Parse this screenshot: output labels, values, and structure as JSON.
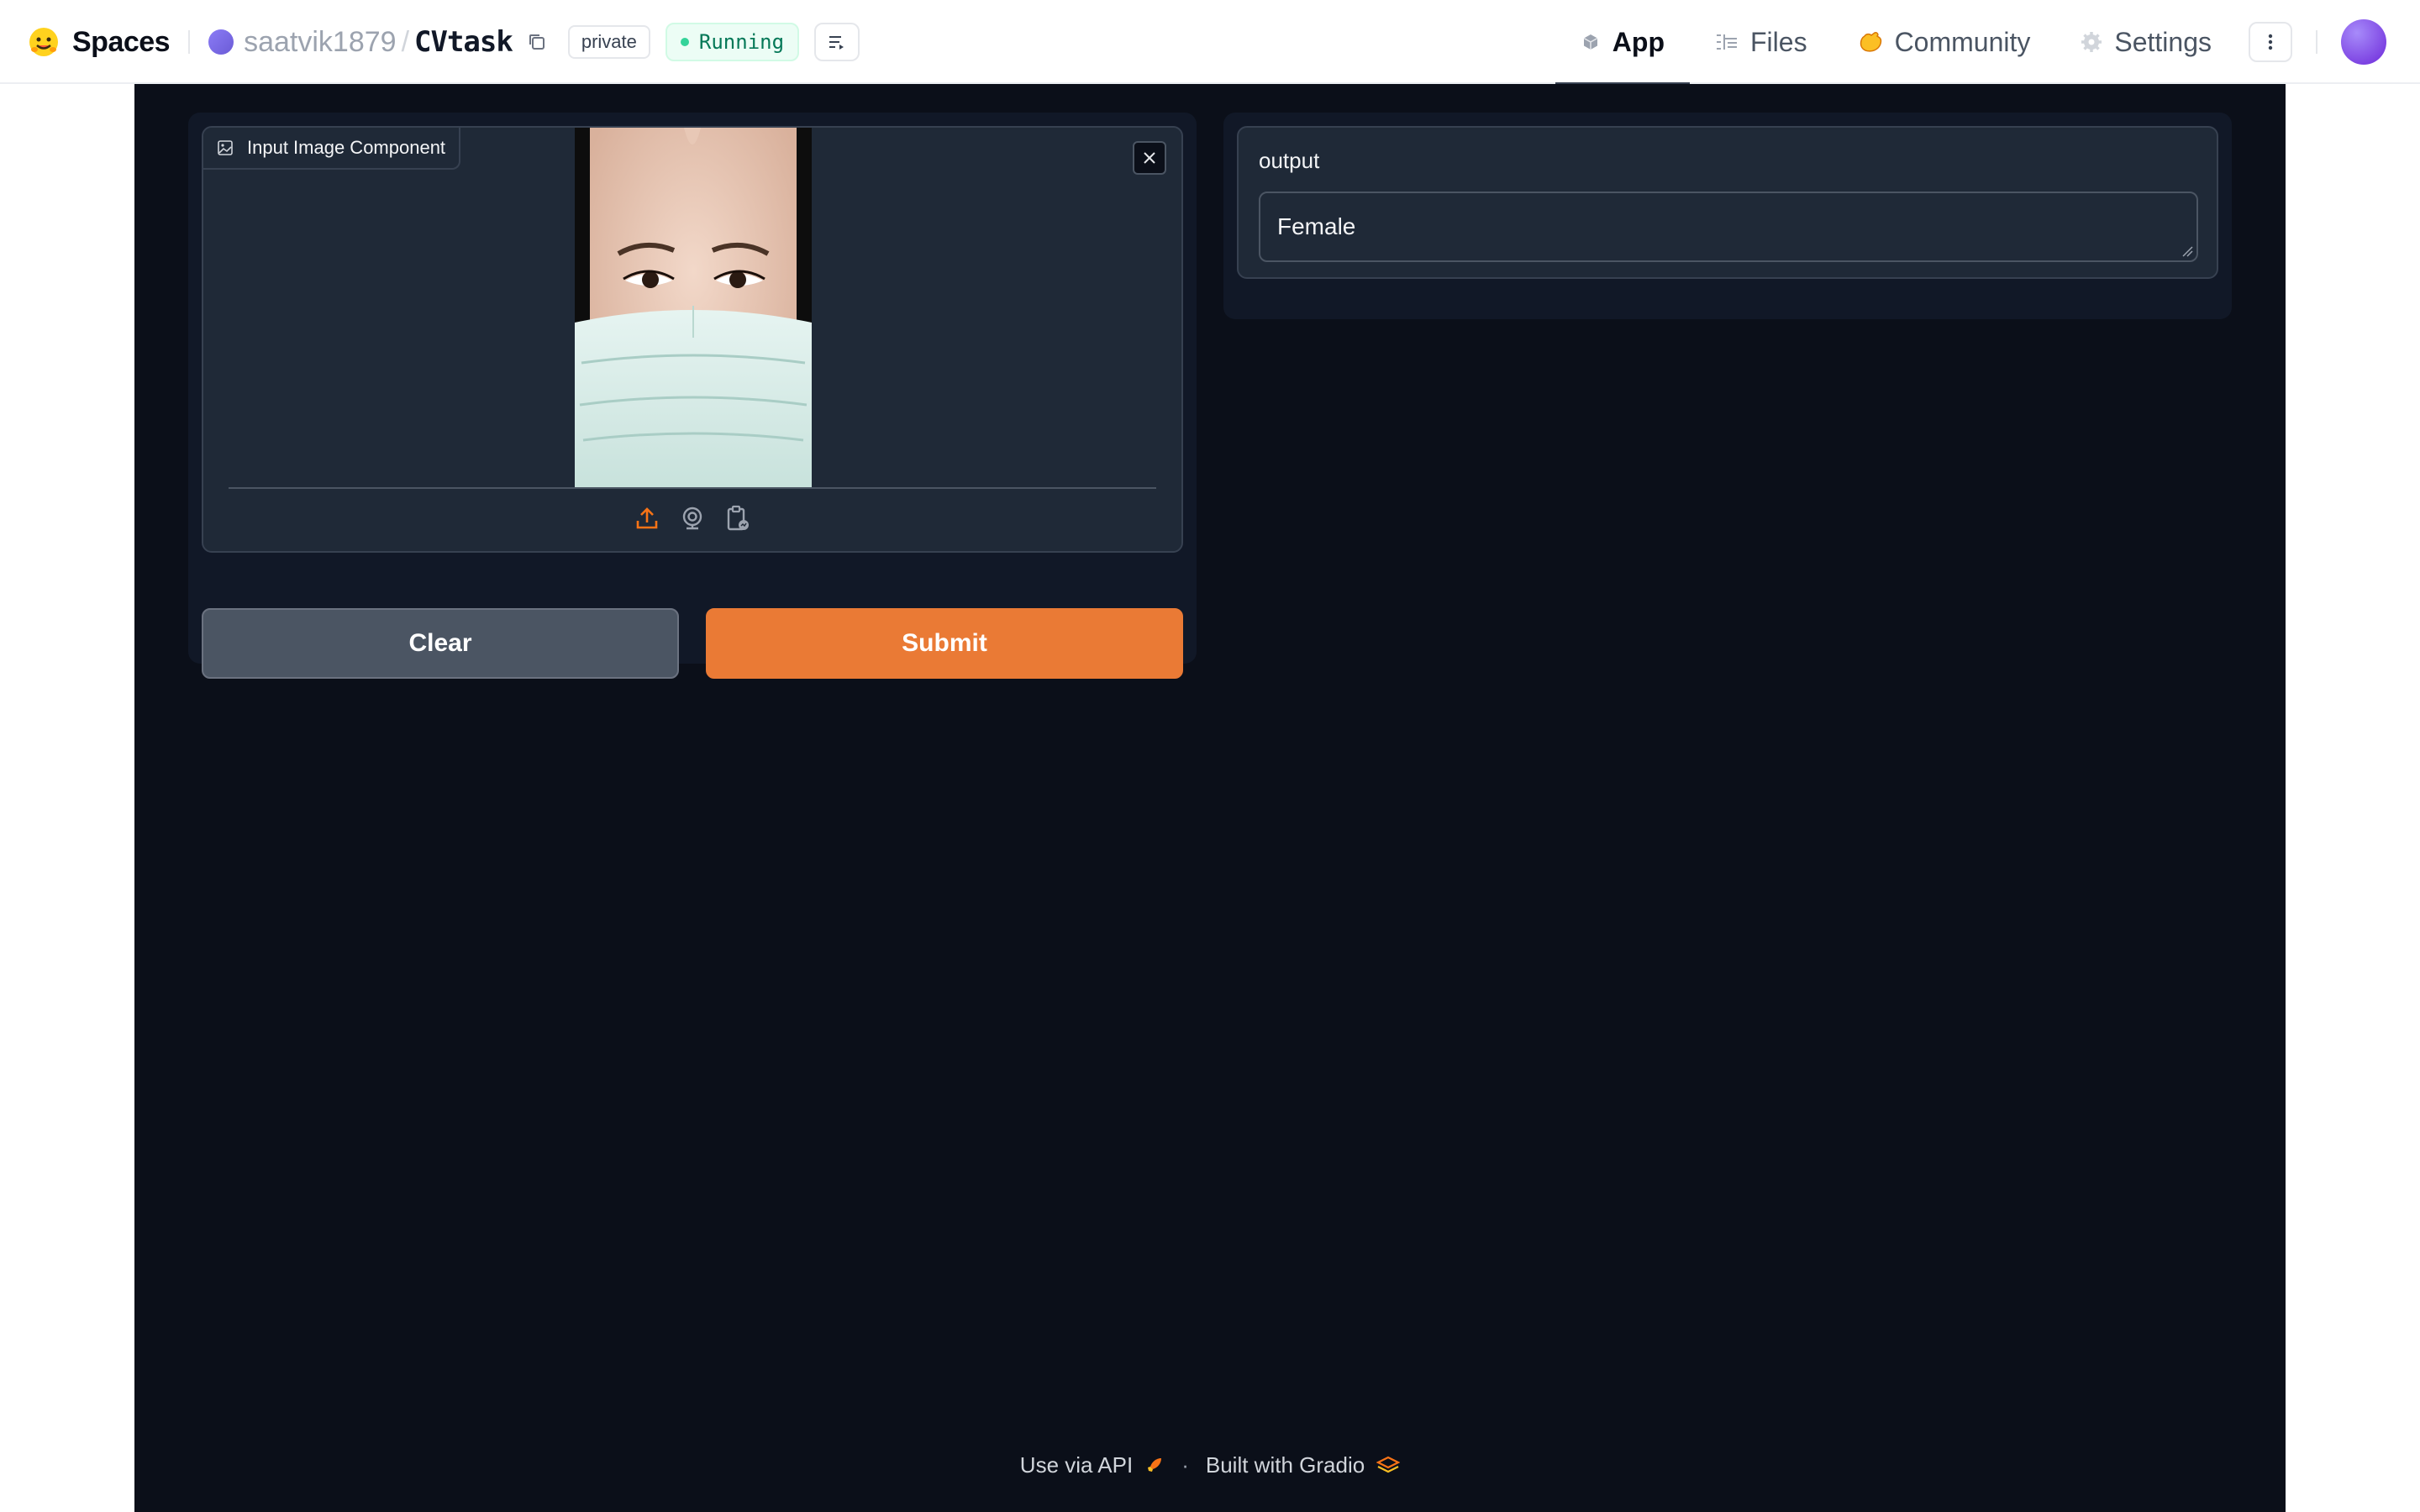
{
  "header": {
    "brand": "Spaces",
    "owner": "saatvik1879",
    "separator": "/",
    "repo": "CVtask",
    "visibility": "private",
    "status": "Running",
    "tabs": [
      {
        "label": "App",
        "icon": "app-icon",
        "active": true
      },
      {
        "label": "Files",
        "icon": "files-icon",
        "active": false
      },
      {
        "label": "Community",
        "icon": "community-icon",
        "active": false
      },
      {
        "label": "Settings",
        "icon": "gear-icon",
        "active": false
      }
    ]
  },
  "input": {
    "label": "Input Image Component",
    "source_icons": [
      "upload-icon",
      "webcam-icon",
      "clipboard-icon"
    ]
  },
  "buttons": {
    "clear": "Clear",
    "submit": "Submit"
  },
  "output": {
    "label": "output",
    "value": "Female"
  },
  "footer": {
    "api": "Use via API",
    "dot": "·",
    "built": "Built with Gradio"
  },
  "colors": {
    "app_bg": "#0b0f19",
    "panel_bg": "#111827",
    "block_bg": "#1f2937",
    "primary": "#ea7a35",
    "secondary": "#4b5563",
    "running_green": "#34d399"
  }
}
